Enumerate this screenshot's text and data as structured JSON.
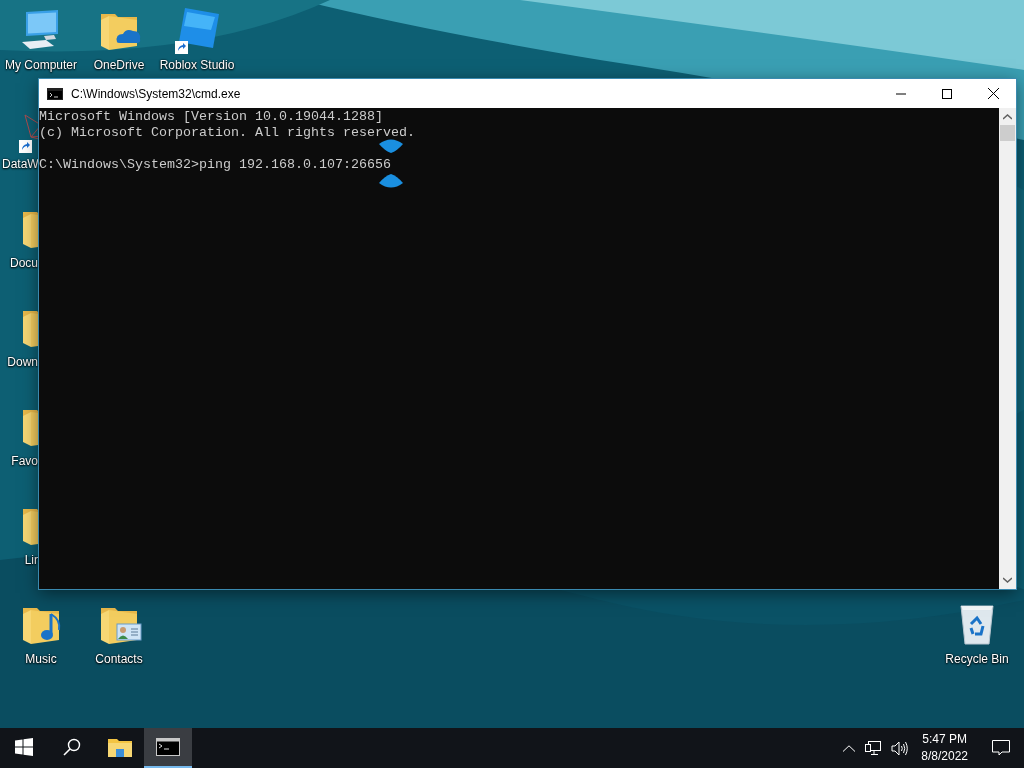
{
  "desktop_icons": [
    {
      "label": "My Computer",
      "kind": "computer",
      "shortcut": false
    },
    {
      "label": "OneDrive",
      "kind": "onedrive",
      "shortcut": false
    },
    {
      "label": "Roblox Studio",
      "kind": "roblox",
      "shortcut": true
    },
    {
      "label": "DataW",
      "kind": "network",
      "shortcut": true
    },
    {
      "label": "Docu",
      "kind": "folder",
      "shortcut": false
    },
    {
      "label": "Down",
      "kind": "folder",
      "shortcut": false
    },
    {
      "label": "Favo",
      "kind": "folder",
      "shortcut": false
    },
    {
      "label": "Lir",
      "kind": "folder",
      "shortcut": false
    },
    {
      "label": "Music",
      "kind": "music",
      "shortcut": false
    },
    {
      "label": "Contacts",
      "kind": "contacts",
      "shortcut": false
    },
    {
      "label": "Recycle Bin",
      "kind": "recycle",
      "shortcut": false
    }
  ],
  "window": {
    "title": "C:\\Windows\\System32\\cmd.exe",
    "lines": [
      "Microsoft Windows [Version 10.0.19044.1288]",
      "(c) Microsoft Corporation. All rights reserved."
    ],
    "prompt_line": "C:\\Windows\\System32>ping 192.168.0.107:26656"
  },
  "taskbar": {
    "apps": [
      {
        "kind": "explorer",
        "selected": false
      },
      {
        "kind": "cmd",
        "selected": true
      }
    ],
    "time": "5:47 PM",
    "date": "8/8/2022"
  }
}
